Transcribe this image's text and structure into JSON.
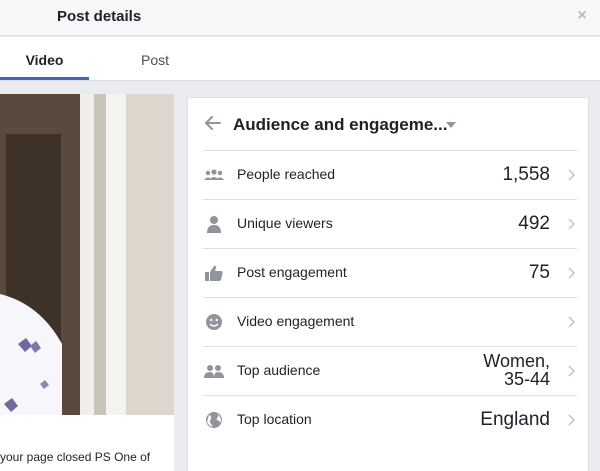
{
  "dialog": {
    "title": "Post details",
    "close_icon": "close-icon"
  },
  "tabs": [
    {
      "label": "Video",
      "active": true
    },
    {
      "label": "Post",
      "active": false
    }
  ],
  "preview": {
    "caption": "your page closed PS One of"
  },
  "insights": {
    "title": "Audience and engageme...",
    "rows": [
      {
        "label": "People reached",
        "value": "1,558",
        "icon": "people-icon"
      },
      {
        "label": "Unique viewers",
        "value": "492",
        "icon": "person-icon"
      },
      {
        "label": "Post engagement",
        "value": "75",
        "icon": "thumbs-up-icon"
      },
      {
        "label": "Video engagement",
        "value": "",
        "icon": "smiley-icon"
      },
      {
        "label": "Top audience",
        "value": "Women, 35-44",
        "icon": "audience-icon"
      },
      {
        "label": "Top location",
        "value": "England",
        "icon": "globe-icon"
      }
    ]
  },
  "colors": {
    "accent": "#4267b2",
    "icon_gray": "#90949c",
    "border": "#dddfe2",
    "background": "#e9ebee"
  }
}
